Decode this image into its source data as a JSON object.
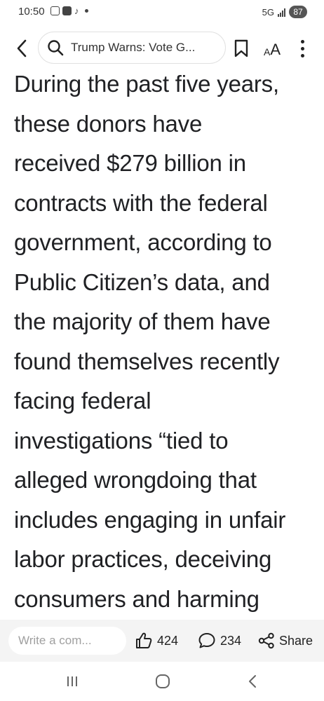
{
  "status_bar": {
    "time": "10:50",
    "network": "5G",
    "battery": "87"
  },
  "toolbar": {
    "search_text": "Trump Warns: Vote G..."
  },
  "article": {
    "lines": [
      "During the past five years,",
      "these donors have",
      "received $279 billion in",
      "contracts with the federal",
      "government, according to",
      "Public Citizen’s data, and",
      "the majority of them have",
      "found themselves recently",
      "facing federal",
      "investigations “tied to",
      "alleged wrongdoing that",
      "includes engaging in unfair",
      "labor practices, deceiving",
      "consumers and harming"
    ]
  },
  "action_bar": {
    "comment_placeholder": "Write a com...",
    "like_count": "424",
    "comment_count": "234",
    "share_label": "Share"
  },
  "icons": {
    "back": "chevron-left-icon",
    "search": "search-icon",
    "bookmark": "bookmark-icon",
    "font_size": "font-size-icon",
    "more": "more-vertical-icon",
    "like": "thumbs-up-icon",
    "comment": "comment-bubble-icon",
    "share": "share-icon",
    "nav_recent": "recent-apps-icon",
    "nav_home": "home-icon",
    "nav_back": "nav-back-icon"
  }
}
